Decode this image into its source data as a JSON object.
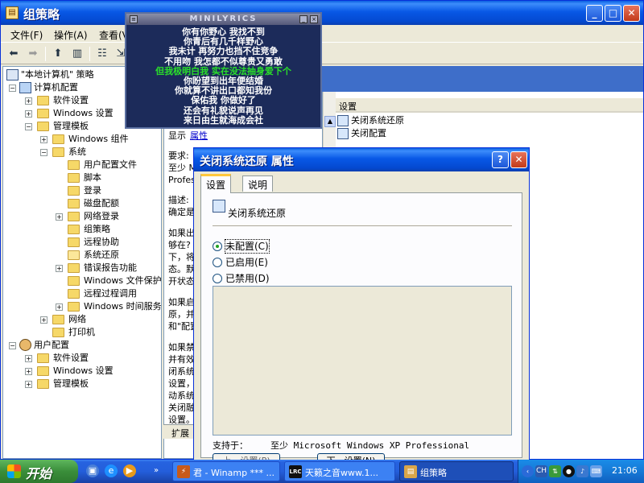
{
  "window": {
    "title": "组策略"
  },
  "menu": {
    "file": "文件(F)",
    "action": "操作(A)",
    "view": "查看(V"
  },
  "tree": {
    "root": "\"本地计算机\" 策略",
    "computer_config": "计算机配置",
    "software_settings": "软件设置",
    "windows_settings": "Windows 设置",
    "admin_templates": "管理模板",
    "windows_components": "Windows 组件",
    "system": "系统",
    "user_profiles": "用户配置文件",
    "scripts": "脚本",
    "logon": "登录",
    "disk_quotas": "磁盘配额",
    "net_logon": "网络登录",
    "group_policy": "组策略",
    "remote_assistance": "远程协助",
    "system_restore": "系统还原",
    "error_reporting": "错误报告功能",
    "windows_file_protection": "Windows 文件保护",
    "rpc": "远程过程调用",
    "windows_time": "Windows 时间服务",
    "network": "网络",
    "printers": "打印机",
    "user_config": "用户配置",
    "u_software_settings": "软件设置",
    "u_windows_settings": "Windows 设置",
    "u_admin_templates": "管理模板"
  },
  "desc": {
    "show": "显示",
    "props_link": "属性",
    "req": "要求:",
    "req2": "至少 M",
    "req3": "Profes",
    "descr": "描述:",
    "descr2": "确定是",
    "p1": "如果出",
    "p2": "够在?",
    "p3": "下，将",
    "p4": "态。默",
    "p5": "开状态",
    "p6": "如果启",
    "p7": "原，并",
    "p8": "和\"配置",
    "p9": "如果禁",
    "p10": "并有效",
    "p11": "闭系统",
    "p12": "设置，",
    "p13": "动系统",
    "p14": "关闭融",
    "p15": "设置。"
  },
  "bottom_tab": {
    "label": "扩展"
  },
  "list": {
    "header": "设置",
    "items": [
      "关闭系统还原",
      "关闭配置"
    ]
  },
  "lyrics": {
    "title": "MINILYRICS",
    "lines": [
      "你有你野心 我找不到",
      "你青后有几千样野心",
      "我未计 再努力也挡不住竞争",
      "不用吻 我怎都不似尊贵又勇敢",
      "但我极明白我 实在没法抽身爱下个",
      "你盼望到出年便结婚",
      "你就算不讲出口都知我份",
      "保佑我 你做好了",
      "还会有礼貌说声再见",
      "来日由生就海成会社"
    ],
    "highlight_index": 4
  },
  "dialog": {
    "title": "关闭系统还原 属性",
    "tab_settings": "设置",
    "tab_explain": "说明",
    "policy_name": "关闭系统还原",
    "opt_not_configured": "未配置(C)",
    "opt_enabled": "已启用(E)",
    "opt_disabled": "已禁用(D)",
    "supported_label": "支持于：",
    "supported_value": "至少 Microsoft Windows XP Professional",
    "btn_prev": "上一设置(P)",
    "btn_next": "下一设置(N)",
    "selected": "not_configured"
  },
  "taskbar": {
    "start": "开始",
    "tasks": [
      {
        "label": "君 - Winamp *** ...",
        "icon": "winamp-icon",
        "active": false
      },
      {
        "label": "天籁之音www.1...",
        "icon": "lrc-icon",
        "active": false
      },
      {
        "label": "组策略",
        "icon": "gpedit-icon",
        "active": true
      }
    ],
    "lrc_badge": "LRC",
    "tray_ch": "CH",
    "clock": "21:06"
  },
  "colors": {
    "xp_blue": "#0449d0",
    "desktop": "#3a6ea5",
    "lyric_highlight": "#2ae02a",
    "start_green": "#3a8e3a"
  }
}
